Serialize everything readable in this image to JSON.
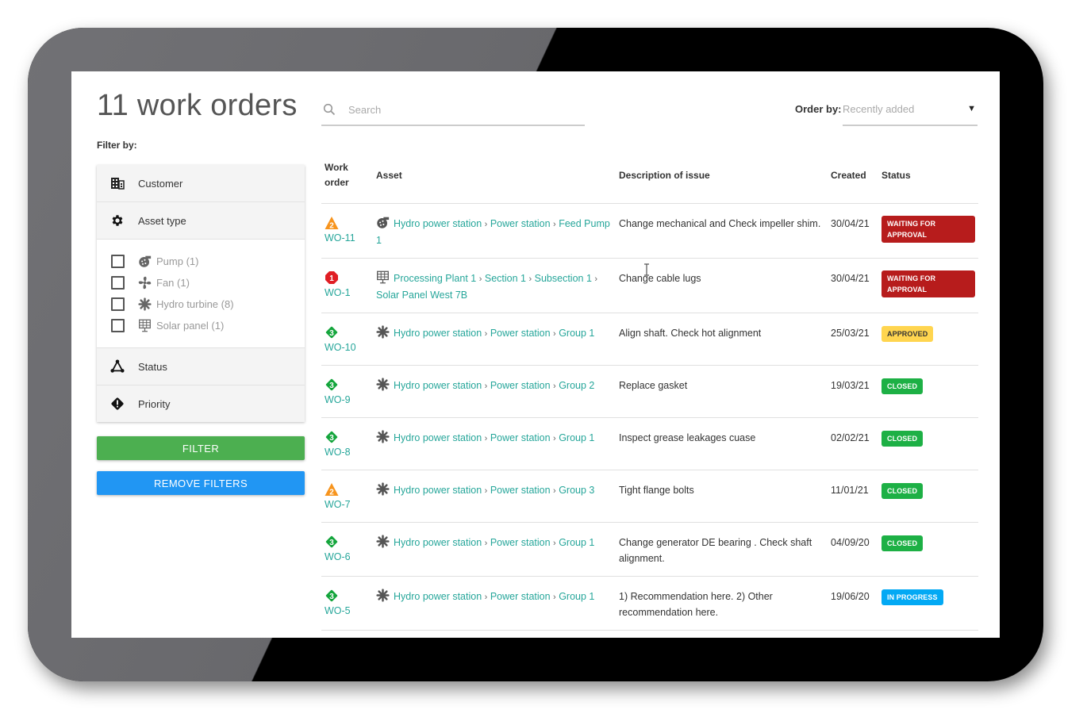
{
  "page": {
    "title": "11 work orders",
    "filter_by_label": "Filter by:"
  },
  "search": {
    "placeholder": "Search",
    "value": ""
  },
  "order_by": {
    "label": "Order by:",
    "selected": "Recently added"
  },
  "filters": {
    "sections": [
      {
        "label": "Customer",
        "icon": "building-icon"
      },
      {
        "label": "Asset type",
        "icon": "gear-icon"
      },
      {
        "label": "Status",
        "icon": "workflow-icon"
      },
      {
        "label": "Priority",
        "icon": "priority-diamond-icon"
      }
    ],
    "asset_type_options": [
      {
        "label": "Pump (1)",
        "icon": "pump-icon",
        "checked": false
      },
      {
        "label": "Fan (1)",
        "icon": "fan-icon",
        "checked": false
      },
      {
        "label": "Hydro turbine (8)",
        "icon": "hydro-turbine-icon",
        "checked": false
      },
      {
        "label": "Solar panel (1)",
        "icon": "solar-panel-icon",
        "checked": false
      }
    ],
    "filter_button": "FILTER",
    "remove_button": "REMOVE FILTERS"
  },
  "table": {
    "headers": {
      "work_order": "Work order",
      "asset": "Asset",
      "description": "Description of issue",
      "created": "Created",
      "status": "Status"
    },
    "separator": "›",
    "status_colors": {
      "WAITING FOR APPROVAL": {
        "bg": "#b71c1c",
        "fg": "#ffffff"
      },
      "APPROVED": {
        "bg": "#ffd54f",
        "fg": "#333333"
      },
      "CLOSED": {
        "bg": "#1db045",
        "fg": "#ffffff"
      },
      "IN PROGRESS": {
        "bg": "#03a9f4",
        "fg": "#ffffff"
      }
    },
    "priority_colors": {
      "1": "#e01e24",
      "2": "#f7941d",
      "3": "#14a53c"
    },
    "rows": [
      {
        "id": "WO-11",
        "priority": "2",
        "asset_icon": "pump-icon",
        "asset_path": [
          "Hydro power station",
          "Power station",
          "Feed Pump 1"
        ],
        "description": "Change mechanical and Check impeller shim.",
        "created": "30/04/21",
        "status": "WAITING FOR APPROVAL"
      },
      {
        "id": "WO-1",
        "priority": "1",
        "asset_icon": "solar-panel-icon",
        "asset_path": [
          "Processing Plant 1",
          "Section 1",
          "Subsection 1",
          "Solar Panel West 7B"
        ],
        "description": "Change cable lugs",
        "created": "30/04/21",
        "status": "WAITING FOR APPROVAL"
      },
      {
        "id": "WO-10",
        "priority": "3",
        "asset_icon": "hydro-turbine-icon",
        "asset_path": [
          "Hydro power station",
          "Power station",
          "Group 1"
        ],
        "description": "Align shaft. Check hot alignment",
        "created": "25/03/21",
        "status": "APPROVED"
      },
      {
        "id": "WO-9",
        "priority": "3",
        "asset_icon": "hydro-turbine-icon",
        "asset_path": [
          "Hydro power station",
          "Power station",
          "Group 2"
        ],
        "description": "Replace gasket",
        "created": "19/03/21",
        "status": "CLOSED"
      },
      {
        "id": "WO-8",
        "priority": "3",
        "asset_icon": "hydro-turbine-icon",
        "asset_path": [
          "Hydro power station",
          "Power station",
          "Group 1"
        ],
        "description": "Inspect grease leakages cuase",
        "created": "02/02/21",
        "status": "CLOSED"
      },
      {
        "id": "WO-7",
        "priority": "2",
        "asset_icon": "hydro-turbine-icon",
        "asset_path": [
          "Hydro power station",
          "Power station",
          "Group 3"
        ],
        "description": "Tight flange bolts",
        "created": "11/01/21",
        "status": "CLOSED"
      },
      {
        "id": "WO-6",
        "priority": "3",
        "asset_icon": "hydro-turbine-icon",
        "asset_path": [
          "Hydro power station",
          "Power station",
          "Group 1"
        ],
        "description": "Change generator DE bearing . Check shaft alignment.",
        "created": "04/09/20",
        "status": "CLOSED"
      },
      {
        "id": "WO-5",
        "priority": "3",
        "asset_icon": "hydro-turbine-icon",
        "asset_path": [
          "Hydro power station",
          "Power station",
          "Group 1"
        ],
        "description": "1) Recommendation here. 2) Other recommendation here.",
        "created": "19/06/20",
        "status": "IN PROGRESS"
      }
    ]
  }
}
